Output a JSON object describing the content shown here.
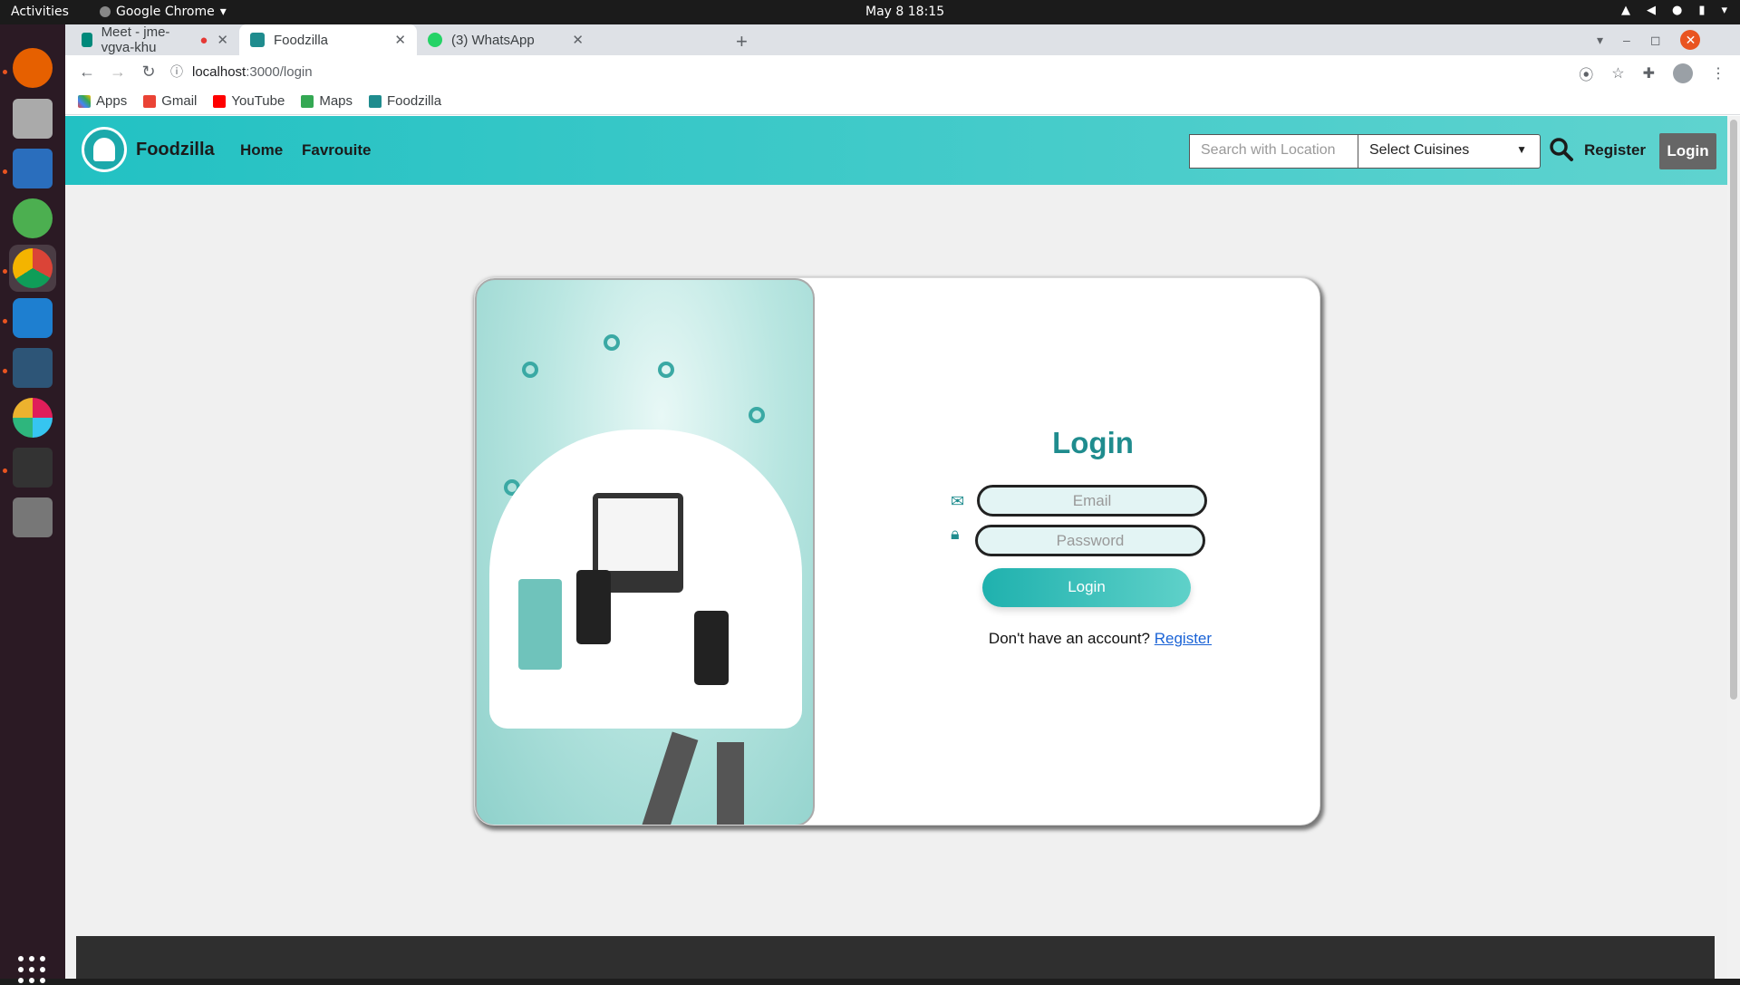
{
  "os": {
    "activities": "Activities",
    "app_name": "Google Chrome",
    "clock": "May 8  18:15"
  },
  "browser": {
    "tabs": [
      {
        "label": "Meet - jme-vgva-khu"
      },
      {
        "label": "Foodzilla"
      },
      {
        "label": "(3) WhatsApp"
      }
    ],
    "url_host": "localhost",
    "url_path": ":3000/login",
    "bookmarks": [
      "Apps",
      "Gmail",
      "YouTube",
      "Maps",
      "Foodzilla"
    ]
  },
  "navbar": {
    "brand": "Foodzilla",
    "links": [
      "Home",
      "Favrouite"
    ],
    "search_placeholder": "Search with Location",
    "cuisine_selected": "Select Cuisines",
    "register": "Register",
    "login": "Login"
  },
  "login_form": {
    "title": "Login",
    "email_placeholder": "Email",
    "password_placeholder": "Password",
    "submit": "Login",
    "signup_prompt": "Don't have an account?",
    "signup_link": "Register"
  },
  "colors": {
    "accent": "#22c1c3",
    "title": "#1f8c8e",
    "footer": "#2f2f2f"
  }
}
